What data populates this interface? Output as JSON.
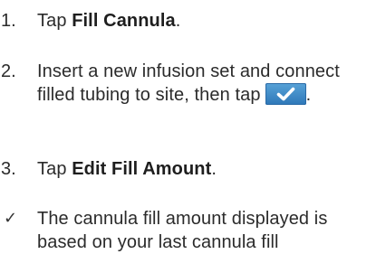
{
  "steps": [
    {
      "number": "1.",
      "prefix": "Tap ",
      "bold": "Fill Cannula",
      "suffix": "."
    },
    {
      "number": "2.",
      "text": "Insert a new infusion set and connect filled tubing to site, then tap",
      "button_icon": "checkmark-icon",
      "suffix": "."
    },
    {
      "number": "3.",
      "prefix": "Tap ",
      "bold": "Edit Fill Amount",
      "suffix": "."
    }
  ],
  "note": {
    "marker": "✓",
    "text": "The cannula fill amount displayed is based on your last cannula fill"
  },
  "colors": {
    "text": "#2b2b2b",
    "button": "#3a86c8"
  }
}
